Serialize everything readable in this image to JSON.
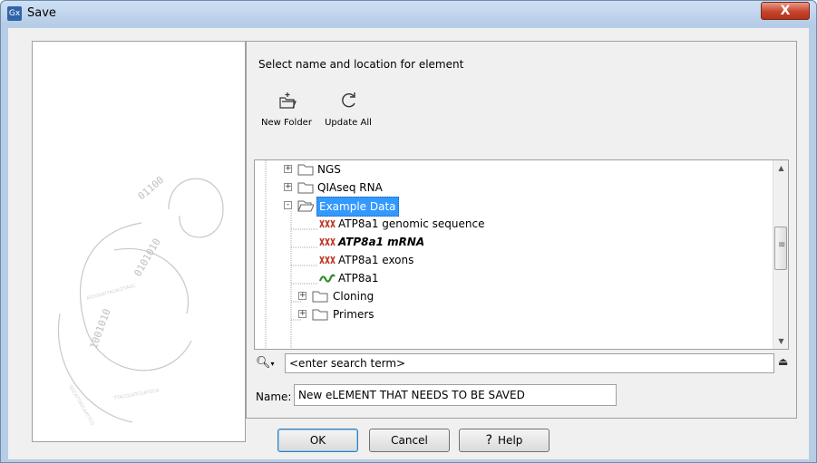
{
  "window": {
    "title": "Save",
    "app_icon_text": "Gx",
    "close_label": "X"
  },
  "instruction": "Select name and location for element",
  "toolbar": {
    "new_folder_label": "New Folder",
    "update_all_label": "Update All"
  },
  "tree": {
    "items": [
      {
        "label": "NGS",
        "type": "folder",
        "expander": "+"
      },
      {
        "label": "QIAseq RNA",
        "type": "folder",
        "expander": "+"
      },
      {
        "label": "Example Data",
        "type": "folder-open",
        "expander": "-",
        "selected": true
      },
      {
        "label": "ATP8a1 genomic sequence",
        "type": "sequence"
      },
      {
        "label": "ATP8a1 mRNA",
        "type": "sequence",
        "emphasis": "bold-italic"
      },
      {
        "label": "ATP8a1 exons",
        "type": "sequence"
      },
      {
        "label": "ATP8a1",
        "type": "protein"
      },
      {
        "label": "Cloning",
        "type": "folder",
        "expander": "+"
      },
      {
        "label": "Primers",
        "type": "folder",
        "expander": "+"
      }
    ]
  },
  "search": {
    "placeholder": "<enter search term>"
  },
  "name_field": {
    "label": "Name:",
    "value": "New eLEMENT THAT NEEDS TO BE SAVED"
  },
  "buttons": {
    "ok": "OK",
    "cancel": "Cancel",
    "help": "Help",
    "help_glyph": "?"
  },
  "colors": {
    "selection": "#3399ff",
    "sequence_icon": "#c0392b",
    "protein_icon": "#2e8b2e"
  }
}
